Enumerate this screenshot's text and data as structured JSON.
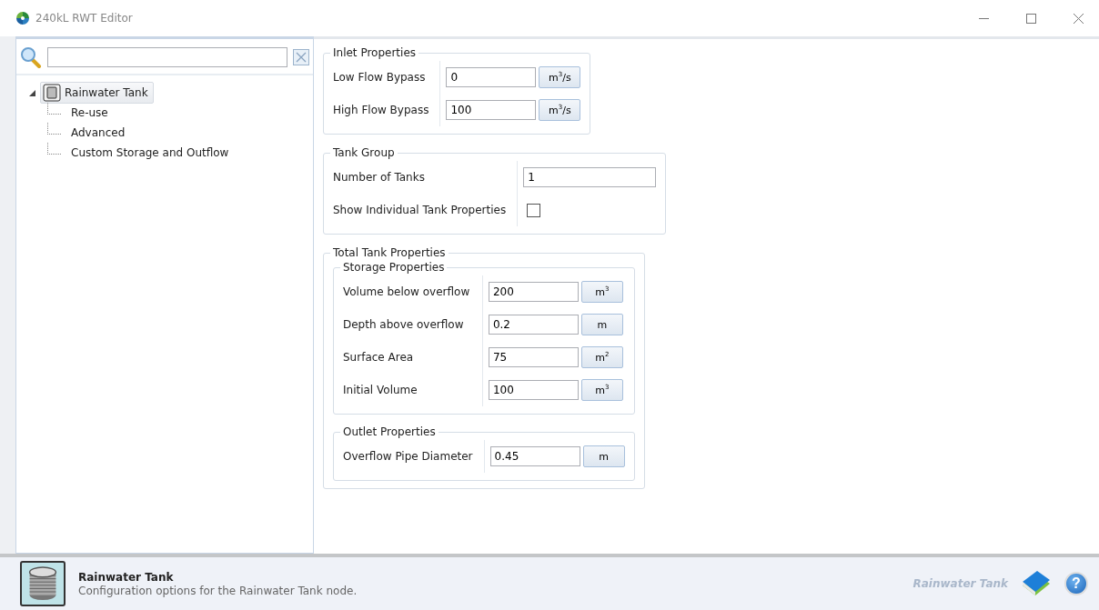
{
  "window": {
    "title": "240kL RWT Editor"
  },
  "tree": [
    {
      "label": "Rainwater Tank",
      "expanded": true,
      "selected": true,
      "children": [
        {
          "label": "Re-use",
          "selected": false
        },
        {
          "label": "Advanced",
          "selected": false
        },
        {
          "label": "Custom Storage and Outflow",
          "selected": false
        }
      ]
    }
  ],
  "groups": [
    {
      "title": "Inlet Properties",
      "rows": [
        {
          "kind": "unit_field",
          "label": "Low Flow Bypass",
          "value": "0",
          "unit": "m$^{3}$/s"
        },
        {
          "kind": "unit_field",
          "label": "High Flow Bypass",
          "value": "100",
          "unit": "m$^{3}$/s"
        }
      ]
    },
    {
      "title": "Tank Group",
      "rows": [
        {
          "kind": "field",
          "label": "Number of Tanks",
          "value": "1"
        },
        {
          "kind": "checkbox",
          "label": "Show Individual Tank Properties",
          "checked": false
        }
      ]
    },
    {
      "title": "Total Tank Properties",
      "groups": [
        {
          "title": "Storage Properties",
          "rows": [
            {
              "kind": "unit_field",
              "label": "Volume below overflow",
              "value": "200",
              "unit": "m$^{3}$"
            },
            {
              "kind": "unit_field",
              "label": "Depth above overflow",
              "value": "0.2",
              "unit": "m"
            },
            {
              "kind": "unit_field",
              "label": "Surface Area",
              "value": "75",
              "unit": "m$^{2}$"
            },
            {
              "kind": "unit_field",
              "label": "Initial Volume",
              "value": "100",
              "unit": "m$^{3}$"
            }
          ]
        },
        {
          "title": "Outlet Properties",
          "rows": [
            {
              "kind": "unit_field",
              "label": "Overflow Pipe Diameter",
              "value": "0.45",
              "unit": "m"
            }
          ]
        }
      ]
    }
  ],
  "footer": {
    "title": "Rainwater Tank",
    "description": "Configuration options for the Rainwater Tank node.",
    "node_name": "Rainwater Tank",
    "help": "?"
  }
}
